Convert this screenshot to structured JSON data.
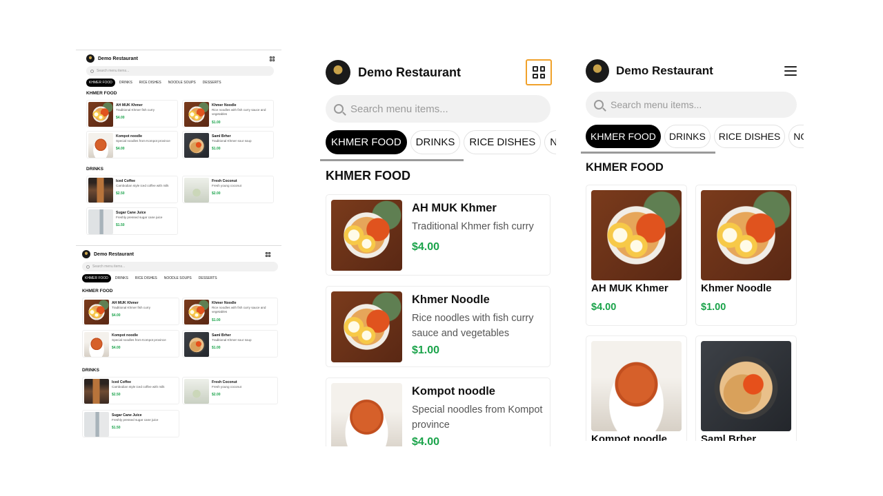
{
  "restaurant_name": "Demo Restaurant",
  "search_placeholder": "Search menu items...",
  "categories": [
    "KHMER FOOD",
    "DRINKS",
    "RICE DISHES",
    "NOODLE SOUPS",
    "DESSERTS"
  ],
  "sections": {
    "khmer_food": "KHMER FOOD",
    "drinks": "DRINKS"
  },
  "khmer_items": [
    {
      "name": "AH MUK Khmer",
      "description": "Traditional Khmer fish curry",
      "price": "$4.00",
      "image": "curry-photo"
    },
    {
      "name": "Khmer Noodle",
      "description": "Rice noodles with fish curry sauce and vegetables",
      "price": "$1.00",
      "image": "curry-photo"
    },
    {
      "name": "Kompot noodle",
      "description": "Special noodles from Kompot province",
      "price": "$4.00",
      "image": "noodle-photo"
    },
    {
      "name": "Saml Brher",
      "description": "Traditional Khmer sour soup",
      "price": "$1.00",
      "image": "soup-photo"
    }
  ],
  "drink_items": [
    {
      "name": "Iced Coffee",
      "description": "Cambodian style iced coffee with milk",
      "price": "$2.50",
      "image": "coffee-photo"
    },
    {
      "name": "Fresh Coconut",
      "description": "Fresh young coconut",
      "price": "$2.00",
      "image": "coconut-photo"
    },
    {
      "name": "Sugar Cane Juice",
      "description": "Freshly pressed sugar cane juice",
      "price": "$1.50",
      "image": "cane-photo"
    }
  ],
  "panel_c_partial_names": [
    "Kompot noodle",
    "Saml Brher"
  ],
  "colors": {
    "accent_price": "#1aa34a",
    "active_tab": "#000000",
    "grid_toggle_border": "#f0a12a"
  },
  "icons": {
    "view_toggle": "grid-view-icon",
    "menu": "hamburger-menu-icon",
    "search": "search-icon"
  }
}
